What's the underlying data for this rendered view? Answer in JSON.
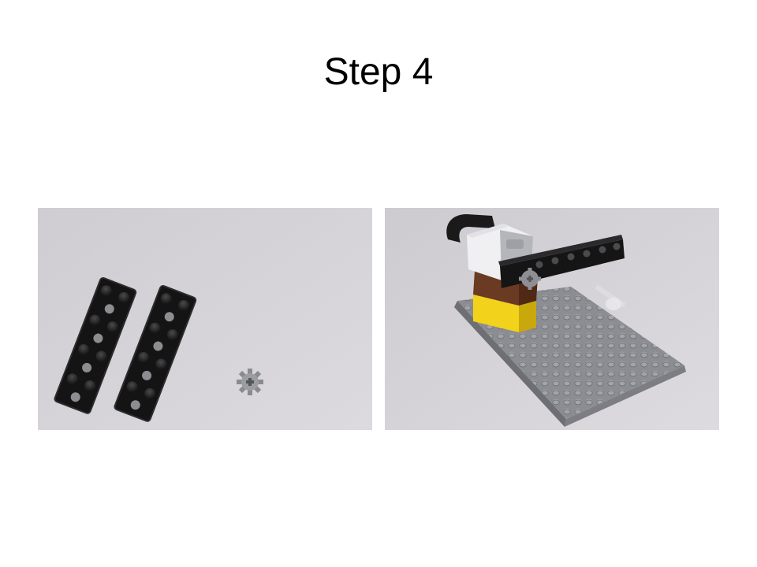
{
  "slide": {
    "title": "Step 4"
  },
  "photos": [
    {
      "name": "parts-photo",
      "contents": [
        "black-technic-plate",
        "black-technic-plate",
        "gray-gear"
      ]
    },
    {
      "name": "assembly-photo",
      "contents": [
        "gray-baseplate",
        "yellow-brick",
        "brown-brick",
        "white-gray-motor",
        "black-technic-plate",
        "gray-gear",
        "black-cable"
      ]
    }
  ]
}
